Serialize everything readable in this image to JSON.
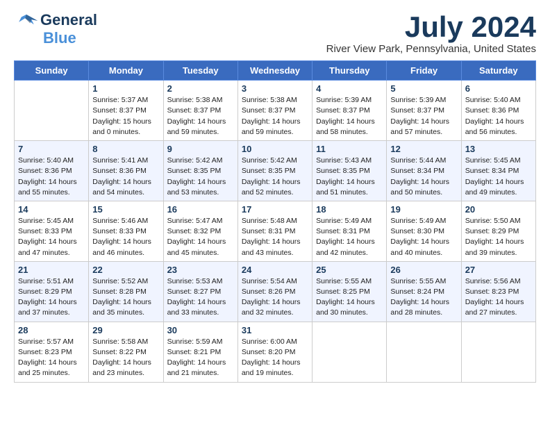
{
  "header": {
    "logo_line1": "General",
    "logo_line2": "Blue",
    "month_title": "July 2024",
    "location": "River View Park, Pennsylvania, United States"
  },
  "days_of_week": [
    "Sunday",
    "Monday",
    "Tuesday",
    "Wednesday",
    "Thursday",
    "Friday",
    "Saturday"
  ],
  "weeks": [
    [
      {
        "day": "",
        "info": ""
      },
      {
        "day": "1",
        "info": "Sunrise: 5:37 AM\nSunset: 8:37 PM\nDaylight: 15 hours\nand 0 minutes."
      },
      {
        "day": "2",
        "info": "Sunrise: 5:38 AM\nSunset: 8:37 PM\nDaylight: 14 hours\nand 59 minutes."
      },
      {
        "day": "3",
        "info": "Sunrise: 5:38 AM\nSunset: 8:37 PM\nDaylight: 14 hours\nand 59 minutes."
      },
      {
        "day": "4",
        "info": "Sunrise: 5:39 AM\nSunset: 8:37 PM\nDaylight: 14 hours\nand 58 minutes."
      },
      {
        "day": "5",
        "info": "Sunrise: 5:39 AM\nSunset: 8:37 PM\nDaylight: 14 hours\nand 57 minutes."
      },
      {
        "day": "6",
        "info": "Sunrise: 5:40 AM\nSunset: 8:36 PM\nDaylight: 14 hours\nand 56 minutes."
      }
    ],
    [
      {
        "day": "7",
        "info": "Sunrise: 5:40 AM\nSunset: 8:36 PM\nDaylight: 14 hours\nand 55 minutes."
      },
      {
        "day": "8",
        "info": "Sunrise: 5:41 AM\nSunset: 8:36 PM\nDaylight: 14 hours\nand 54 minutes."
      },
      {
        "day": "9",
        "info": "Sunrise: 5:42 AM\nSunset: 8:35 PM\nDaylight: 14 hours\nand 53 minutes."
      },
      {
        "day": "10",
        "info": "Sunrise: 5:42 AM\nSunset: 8:35 PM\nDaylight: 14 hours\nand 52 minutes."
      },
      {
        "day": "11",
        "info": "Sunrise: 5:43 AM\nSunset: 8:35 PM\nDaylight: 14 hours\nand 51 minutes."
      },
      {
        "day": "12",
        "info": "Sunrise: 5:44 AM\nSunset: 8:34 PM\nDaylight: 14 hours\nand 50 minutes."
      },
      {
        "day": "13",
        "info": "Sunrise: 5:45 AM\nSunset: 8:34 PM\nDaylight: 14 hours\nand 49 minutes."
      }
    ],
    [
      {
        "day": "14",
        "info": "Sunrise: 5:45 AM\nSunset: 8:33 PM\nDaylight: 14 hours\nand 47 minutes."
      },
      {
        "day": "15",
        "info": "Sunrise: 5:46 AM\nSunset: 8:33 PM\nDaylight: 14 hours\nand 46 minutes."
      },
      {
        "day": "16",
        "info": "Sunrise: 5:47 AM\nSunset: 8:32 PM\nDaylight: 14 hours\nand 45 minutes."
      },
      {
        "day": "17",
        "info": "Sunrise: 5:48 AM\nSunset: 8:31 PM\nDaylight: 14 hours\nand 43 minutes."
      },
      {
        "day": "18",
        "info": "Sunrise: 5:49 AM\nSunset: 8:31 PM\nDaylight: 14 hours\nand 42 minutes."
      },
      {
        "day": "19",
        "info": "Sunrise: 5:49 AM\nSunset: 8:30 PM\nDaylight: 14 hours\nand 40 minutes."
      },
      {
        "day": "20",
        "info": "Sunrise: 5:50 AM\nSunset: 8:29 PM\nDaylight: 14 hours\nand 39 minutes."
      }
    ],
    [
      {
        "day": "21",
        "info": "Sunrise: 5:51 AM\nSunset: 8:29 PM\nDaylight: 14 hours\nand 37 minutes."
      },
      {
        "day": "22",
        "info": "Sunrise: 5:52 AM\nSunset: 8:28 PM\nDaylight: 14 hours\nand 35 minutes."
      },
      {
        "day": "23",
        "info": "Sunrise: 5:53 AM\nSunset: 8:27 PM\nDaylight: 14 hours\nand 33 minutes."
      },
      {
        "day": "24",
        "info": "Sunrise: 5:54 AM\nSunset: 8:26 PM\nDaylight: 14 hours\nand 32 minutes."
      },
      {
        "day": "25",
        "info": "Sunrise: 5:55 AM\nSunset: 8:25 PM\nDaylight: 14 hours\nand 30 minutes."
      },
      {
        "day": "26",
        "info": "Sunrise: 5:55 AM\nSunset: 8:24 PM\nDaylight: 14 hours\nand 28 minutes."
      },
      {
        "day": "27",
        "info": "Sunrise: 5:56 AM\nSunset: 8:23 PM\nDaylight: 14 hours\nand 27 minutes."
      }
    ],
    [
      {
        "day": "28",
        "info": "Sunrise: 5:57 AM\nSunset: 8:23 PM\nDaylight: 14 hours\nand 25 minutes."
      },
      {
        "day": "29",
        "info": "Sunrise: 5:58 AM\nSunset: 8:22 PM\nDaylight: 14 hours\nand 23 minutes."
      },
      {
        "day": "30",
        "info": "Sunrise: 5:59 AM\nSunset: 8:21 PM\nDaylight: 14 hours\nand 21 minutes."
      },
      {
        "day": "31",
        "info": "Sunrise: 6:00 AM\nSunset: 8:20 PM\nDaylight: 14 hours\nand 19 minutes."
      },
      {
        "day": "",
        "info": ""
      },
      {
        "day": "",
        "info": ""
      },
      {
        "day": "",
        "info": ""
      }
    ]
  ]
}
